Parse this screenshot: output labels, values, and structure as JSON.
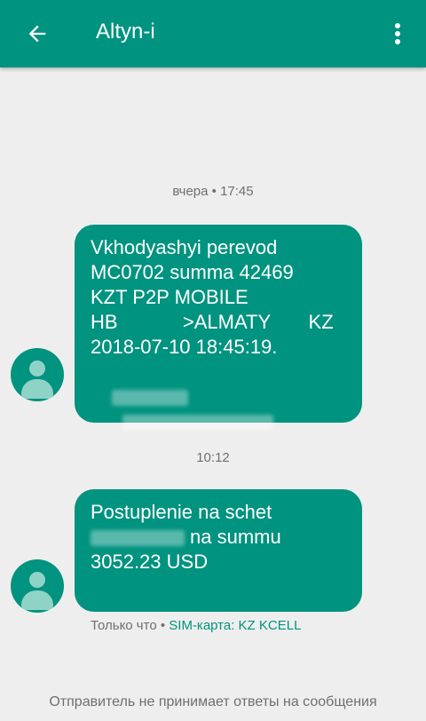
{
  "header": {
    "title": "Altyn-i",
    "back_icon": "arrow-back-icon",
    "menu_icon": "more-vert-icon"
  },
  "colors": {
    "accent": "#00937f",
    "background": "#eeeeee"
  },
  "messages": [
    {
      "timestamp": "вчера • 17:45",
      "lines": [
        "Vkhodyashyi perevod",
        "MC0702 summa 42469",
        "KZT P2P MOBILE",
        "HB            >ALMATY       KZ",
        "2018-07-10 18:45:19."
      ]
    },
    {
      "timestamp": "10:12",
      "line1": "Postuplenie na schet",
      "line2_suffix": "na summu",
      "line3": "3052.23 USD",
      "status_prefix": "Только что •",
      "sim_label": "SIM-карта: KZ KCELL"
    }
  ],
  "footer": {
    "note": "Отправитель не принимает ответы на сообщения"
  }
}
